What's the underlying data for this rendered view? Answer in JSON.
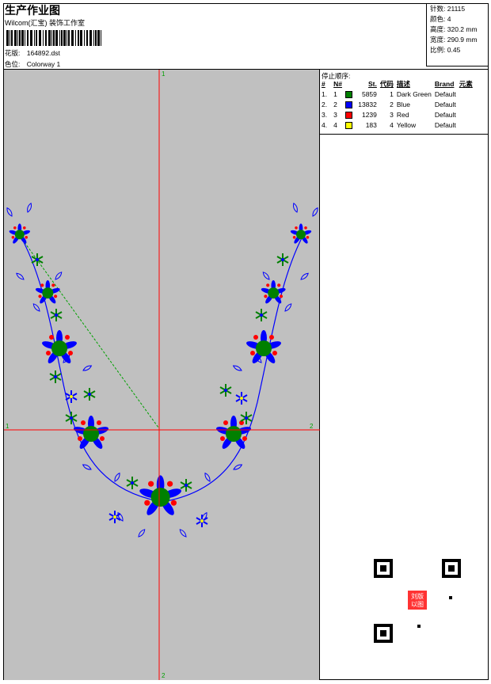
{
  "header": {
    "title": "生产作业图",
    "company": "Wilcom(汇宝) 装饰工作室",
    "pattern_label": "花版:",
    "pattern_value": "164892.dst",
    "colorway_label": "色位:",
    "colorway_value": "Colorway 1"
  },
  "stats": [
    {
      "label": "针数:",
      "value": "21115"
    },
    {
      "label": "颜色:",
      "value": "4"
    },
    {
      "label": "高度:",
      "value": "320.2 mm"
    },
    {
      "label": "宽度:",
      "value": "290.9 mm"
    },
    {
      "label": "比例:",
      "value": "0.45"
    }
  ],
  "color_panel": {
    "title": "停止顺序:",
    "headers": [
      "#",
      "N#",
      "St.",
      "代码",
      "描述",
      "Brand",
      "元素"
    ],
    "rows": [
      {
        "idx": "1.",
        "n": "1",
        "stitches": "5859",
        "code": "1",
        "desc": "Dark Green",
        "brand": "Default",
        "color": "#008000"
      },
      {
        "idx": "2.",
        "n": "2",
        "stitches": "13832",
        "code": "2",
        "desc": "Blue",
        "brand": "Default",
        "color": "#0000ff"
      },
      {
        "idx": "3.",
        "n": "3",
        "stitches": "1239",
        "code": "3",
        "desc": "Red",
        "brand": "Default",
        "color": "#ff0000"
      },
      {
        "idx": "4.",
        "n": "4",
        "stitches": "183",
        "code": "4",
        "desc": "Yellow",
        "brand": "Default",
        "color": "#ffff00"
      }
    ]
  },
  "axis_labels": {
    "top": "1",
    "bottom": "2",
    "left": "1",
    "right": "2"
  },
  "qr_stamp": {
    "text": "刘版以图"
  },
  "colors": {
    "canvas_bg": "#c0c0c0",
    "axis": "#ff0000",
    "axis_label": "#00a000",
    "path": "#00a000"
  }
}
